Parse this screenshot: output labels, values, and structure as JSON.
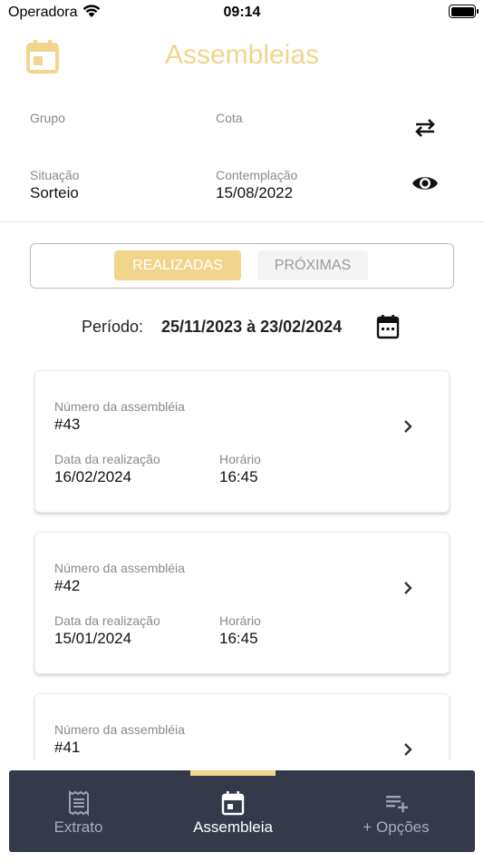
{
  "status_bar": {
    "carrier": "Operadora",
    "time": "09:14"
  },
  "header": {
    "title": "Assembleias",
    "icon": "calendar-icon",
    "accent_color": "#f2d58c"
  },
  "info": {
    "grupo_label": "Grupo",
    "grupo_value": "",
    "cota_label": "Cota",
    "cota_value": "",
    "situacao_label": "Situação",
    "situacao_value": "Sorteio",
    "contemplacao_label": "Contemplação",
    "contemplacao_value": "15/08/2022"
  },
  "segmented": {
    "active": "REALIZADAS",
    "inactive": "PRÓXIMAS"
  },
  "period": {
    "label": "Período:",
    "range": "25/11/2023 à 23/02/2024"
  },
  "assemblies": [
    {
      "numero_label": "Número da assembléia",
      "numero": "#43",
      "data_label": "Data da realização",
      "data": "16/02/2024",
      "horario_label": "Horário",
      "horario": "16:45"
    },
    {
      "numero_label": "Número da assembléia",
      "numero": "#42",
      "data_label": "Data da realização",
      "data": "15/01/2024",
      "horario_label": "Horário",
      "horario": "16:45"
    },
    {
      "numero_label": "Número da assembléia",
      "numero": "#41",
      "data_label": "",
      "data": "",
      "horario_label": "",
      "horario": ""
    }
  ],
  "tabbar": {
    "background": "#353a4b",
    "tabs": [
      {
        "label": "Extrato",
        "icon": "receipt-icon",
        "active": false
      },
      {
        "label": "Assembleia",
        "icon": "calendar-icon",
        "active": true
      },
      {
        "label": "+ Opções",
        "icon": "playlist-add-icon",
        "active": false
      }
    ]
  }
}
